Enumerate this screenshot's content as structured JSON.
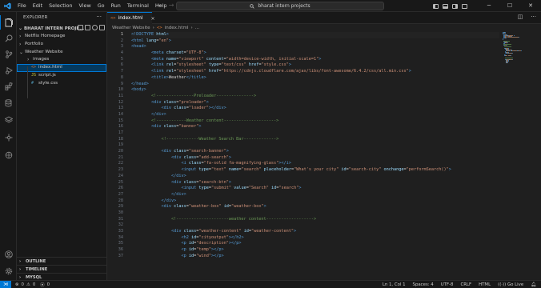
{
  "menu": [
    "File",
    "Edit",
    "Selection",
    "View",
    "Go",
    "Run",
    "Terminal",
    "Help"
  ],
  "search": {
    "text": "bharat intern projects"
  },
  "sidebar": {
    "title": "EXPLORER",
    "project": "BHARAT INTERN PROJE...",
    "items": [
      {
        "label": "Netflix Homepage",
        "type": "folder",
        "expanded": false,
        "depth": 1
      },
      {
        "label": "Portfolio",
        "type": "folder",
        "expanded": false,
        "depth": 1
      },
      {
        "label": "Weather Website",
        "type": "folder",
        "expanded": true,
        "depth": 1
      },
      {
        "label": "images",
        "type": "folder",
        "expanded": false,
        "depth": 2
      },
      {
        "label": "index.html",
        "type": "html",
        "selected": true,
        "depth": 2
      },
      {
        "label": "script.js",
        "type": "js",
        "depth": 2
      },
      {
        "label": "style.css",
        "type": "css",
        "depth": 2
      }
    ],
    "sections": [
      "OUTLINE",
      "TIMELINE",
      "MYSQL"
    ]
  },
  "tab": {
    "label": "index.html",
    "close": "×"
  },
  "breadcrumb": {
    "folder": "Weather Website",
    "sep": "›",
    "file": "index.html",
    "sep2": "›",
    "more": "..."
  },
  "editor": {
    "lines": [
      [
        [
          "tag",
          "<!DOCTYPE "
        ],
        [
          "attr",
          "html"
        ],
        [
          "tag",
          ">"
        ]
      ],
      [
        [
          "tag",
          "<html "
        ],
        [
          "attr",
          "lang"
        ],
        [
          "txt",
          "="
        ],
        [
          "str",
          "\"en\""
        ],
        [
          "tag",
          ">"
        ]
      ],
      [
        [
          "tag",
          "<head>"
        ]
      ],
      [
        [
          "txt",
          "        "
        ],
        [
          "tag",
          "<meta "
        ],
        [
          "attr",
          "charset"
        ],
        [
          "txt",
          "="
        ],
        [
          "str",
          "\"UTF-8\""
        ],
        [
          "tag",
          ">"
        ]
      ],
      [
        [
          "txt",
          "        "
        ],
        [
          "tag",
          "<meta "
        ],
        [
          "attr",
          "name"
        ],
        [
          "txt",
          "="
        ],
        [
          "str",
          "\"viewport\""
        ],
        [
          "txt",
          " "
        ],
        [
          "attr",
          "content"
        ],
        [
          "txt",
          "="
        ],
        [
          "str",
          "\"width=device-width, initial-scale=1\""
        ],
        [
          "tag",
          ">"
        ]
      ],
      [
        [
          "txt",
          "        "
        ],
        [
          "tag",
          "<link "
        ],
        [
          "attr",
          "rel"
        ],
        [
          "txt",
          "="
        ],
        [
          "str",
          "\"stylesheet\""
        ],
        [
          "txt",
          " "
        ],
        [
          "attr",
          "type"
        ],
        [
          "txt",
          "="
        ],
        [
          "str",
          "\"text/css\""
        ],
        [
          "txt",
          " "
        ],
        [
          "attr",
          "href"
        ],
        [
          "txt",
          "="
        ],
        [
          "str",
          "\"style.css\""
        ],
        [
          "tag",
          ">"
        ]
      ],
      [
        [
          "txt",
          "        "
        ],
        [
          "tag",
          "<link "
        ],
        [
          "attr",
          "rel"
        ],
        [
          "txt",
          "="
        ],
        [
          "str",
          "\"stylesheet\""
        ],
        [
          "txt",
          " "
        ],
        [
          "attr",
          "href"
        ],
        [
          "txt",
          "="
        ],
        [
          "str",
          "\"https://cdnjs.cloudflare.com/ajax/libs/font-awesome/6.4.2/css/all.min.css\""
        ],
        [
          "tag",
          ">"
        ]
      ],
      [
        [
          "txt",
          "        "
        ],
        [
          "tag",
          "<title>"
        ],
        [
          "txt",
          "Weather"
        ],
        [
          "tag",
          "</title>"
        ]
      ],
      [
        [
          "tag",
          "</head>"
        ]
      ],
      [
        [
          "tag",
          "<body>"
        ]
      ],
      [
        [
          "txt",
          "        "
        ],
        [
          "cm",
          "<!---------------Preloader--------------->"
        ]
      ],
      [
        [
          "txt",
          "        "
        ],
        [
          "tag",
          "<div "
        ],
        [
          "attr",
          "class"
        ],
        [
          "txt",
          "="
        ],
        [
          "str",
          "\"preloader\""
        ],
        [
          "tag",
          ">"
        ]
      ],
      [
        [
          "txt",
          "            "
        ],
        [
          "tag",
          "<div "
        ],
        [
          "attr",
          "class"
        ],
        [
          "txt",
          "="
        ],
        [
          "str",
          "\"loader\""
        ],
        [
          "tag",
          "></div>"
        ]
      ],
      [
        [
          "txt",
          "        "
        ],
        [
          "tag",
          "</div>"
        ]
      ],
      [
        [
          "txt",
          "        "
        ],
        [
          "cm",
          "<!------------Weather content--------------------->"
        ]
      ],
      [
        [
          "txt",
          "        "
        ],
        [
          "tag",
          "<div "
        ],
        [
          "attr",
          "class"
        ],
        [
          "txt",
          "="
        ],
        [
          "str",
          "\"banner\""
        ],
        [
          "tag",
          ">"
        ]
      ],
      [
        [
          "txt",
          ""
        ]
      ],
      [
        [
          "txt",
          "            "
        ],
        [
          "cm",
          "<!-------------Weather Search Bar------------->"
        ]
      ],
      [
        [
          "txt",
          ""
        ]
      ],
      [
        [
          "txt",
          "            "
        ],
        [
          "tag",
          "<div "
        ],
        [
          "attr",
          "class"
        ],
        [
          "txt",
          "="
        ],
        [
          "str",
          "\"search-banner\""
        ],
        [
          "tag",
          ">"
        ]
      ],
      [
        [
          "txt",
          "                "
        ],
        [
          "tag",
          "<div "
        ],
        [
          "attr",
          "class"
        ],
        [
          "txt",
          "="
        ],
        [
          "str",
          "\"add-search\""
        ],
        [
          "tag",
          ">"
        ]
      ],
      [
        [
          "txt",
          "                    "
        ],
        [
          "tag",
          "<i "
        ],
        [
          "attr",
          "class"
        ],
        [
          "txt",
          "="
        ],
        [
          "str",
          "\"fa-solid fa-magnifying-glass\""
        ],
        [
          "tag",
          "></i>"
        ]
      ],
      [
        [
          "txt",
          "                    "
        ],
        [
          "tag",
          "<input "
        ],
        [
          "attr",
          "type"
        ],
        [
          "txt",
          "="
        ],
        [
          "str",
          "\"text\""
        ],
        [
          "txt",
          " "
        ],
        [
          "attr",
          "name"
        ],
        [
          "txt",
          "="
        ],
        [
          "str",
          "\"search\""
        ],
        [
          "txt",
          " "
        ],
        [
          "attr",
          "placeholder"
        ],
        [
          "txt",
          "="
        ],
        [
          "str",
          "\"What's your city\""
        ],
        [
          "txt",
          " "
        ],
        [
          "attr",
          "id"
        ],
        [
          "txt",
          "="
        ],
        [
          "str",
          "\"search-city\""
        ],
        [
          "txt",
          " "
        ],
        [
          "attr",
          "onchange"
        ],
        [
          "txt",
          "="
        ],
        [
          "str",
          "\"performSearch()\""
        ],
        [
          "tag",
          ">"
        ]
      ],
      [
        [
          "txt",
          "                "
        ],
        [
          "tag",
          "</div>"
        ]
      ],
      [
        [
          "txt",
          "                "
        ],
        [
          "tag",
          "<div "
        ],
        [
          "attr",
          "class"
        ],
        [
          "txt",
          "="
        ],
        [
          "str",
          "\"search-btn\""
        ],
        [
          "tag",
          ">"
        ]
      ],
      [
        [
          "txt",
          "                    "
        ],
        [
          "tag",
          "<input "
        ],
        [
          "attr",
          "type"
        ],
        [
          "txt",
          "="
        ],
        [
          "str",
          "\"submit\""
        ],
        [
          "txt",
          " "
        ],
        [
          "attr",
          "value"
        ],
        [
          "txt",
          "="
        ],
        [
          "str",
          "\"Search\""
        ],
        [
          "txt",
          " "
        ],
        [
          "attr",
          "id"
        ],
        [
          "txt",
          "="
        ],
        [
          "str",
          "\"search\""
        ],
        [
          "tag",
          ">"
        ]
      ],
      [
        [
          "txt",
          "                "
        ],
        [
          "tag",
          "</div>"
        ]
      ],
      [
        [
          "txt",
          "            "
        ],
        [
          "tag",
          "</div>"
        ]
      ],
      [
        [
          "txt",
          "            "
        ],
        [
          "tag",
          "<div "
        ],
        [
          "attr",
          "class"
        ],
        [
          "txt",
          "="
        ],
        [
          "str",
          "\"weather-box\""
        ],
        [
          "txt",
          " "
        ],
        [
          "attr",
          "id"
        ],
        [
          "txt",
          "="
        ],
        [
          "str",
          "\"weather-box\""
        ],
        [
          "tag",
          ">"
        ]
      ],
      [
        [
          "txt",
          ""
        ]
      ],
      [
        [
          "txt",
          "                "
        ],
        [
          "cm",
          "<!---------------------weather content------------------->"
        ]
      ],
      [
        [
          "txt",
          ""
        ]
      ],
      [
        [
          "txt",
          "                "
        ],
        [
          "tag",
          "<div "
        ],
        [
          "attr",
          "class"
        ],
        [
          "txt",
          "="
        ],
        [
          "str",
          "\"weather-content\""
        ],
        [
          "txt",
          " "
        ],
        [
          "attr",
          "id"
        ],
        [
          "txt",
          "="
        ],
        [
          "str",
          "\"weather-content\""
        ],
        [
          "tag",
          ">"
        ]
      ],
      [
        [
          "txt",
          "                    "
        ],
        [
          "tag",
          "<h2 "
        ],
        [
          "attr",
          "id"
        ],
        [
          "txt",
          "="
        ],
        [
          "str",
          "\"cityoutput\""
        ],
        [
          "tag",
          "></h2>"
        ]
      ],
      [
        [
          "txt",
          "                    "
        ],
        [
          "tag",
          "<p "
        ],
        [
          "attr",
          "id"
        ],
        [
          "txt",
          "="
        ],
        [
          "str",
          "\"description\""
        ],
        [
          "tag",
          "></p>"
        ]
      ],
      [
        [
          "txt",
          "                    "
        ],
        [
          "tag",
          "<p "
        ],
        [
          "attr",
          "id"
        ],
        [
          "txt",
          "="
        ],
        [
          "str",
          "\"temp\""
        ],
        [
          "tag",
          "></p>"
        ]
      ],
      [
        [
          "txt",
          "                    "
        ],
        [
          "tag",
          "<p "
        ],
        [
          "attr",
          "id"
        ],
        [
          "txt",
          "="
        ],
        [
          "str",
          "\"wind\""
        ],
        [
          "tag",
          "></p>"
        ]
      ]
    ]
  },
  "statusbar": {
    "errors": "0",
    "warnings": "0",
    "ports": "0",
    "position": "Ln 1, Col 1",
    "spaces": "Spaces: 4",
    "encoding": "UTF-8",
    "eol": "CRLF",
    "language": "HTML",
    "golive": "Go Live"
  },
  "colors": {
    "accent": "#0078d4",
    "tag": "#569cd6",
    "attr": "#9cdcfe",
    "string": "#ce9178",
    "comment": "#6a9955",
    "html_icon": "#e37933",
    "js_icon": "#cbcb41",
    "css_icon": "#519aba",
    "selection": "#04395e"
  }
}
